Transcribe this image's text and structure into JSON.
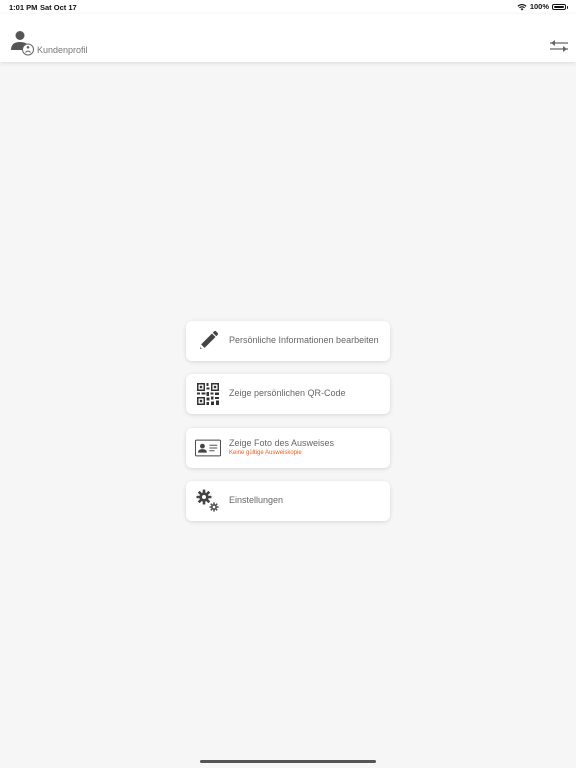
{
  "status_bar": {
    "time": "1:01 PM",
    "date": "Sat Oct 17",
    "battery": "100%"
  },
  "header": {
    "title": "Kundenprofil",
    "profile_icon": "user-account-icon",
    "filter_icon": "sliders-icon"
  },
  "menu": {
    "items": [
      {
        "label": "Persönliche Informationen bearbeiten",
        "icon": "pencil-icon"
      },
      {
        "label": "Zeige persönlichen QR-Code",
        "icon": "qr-code-icon"
      },
      {
        "label": "Zeige Foto des Ausweises",
        "sublabel": "Keine gültige Ausweiskopie",
        "icon": "id-card-icon"
      },
      {
        "label": "Einstellungen",
        "icon": "gears-icon"
      }
    ]
  },
  "colors": {
    "background": "#f6f6f6",
    "card": "#ffffff",
    "text": "#666666",
    "warning": "#e8601c"
  }
}
